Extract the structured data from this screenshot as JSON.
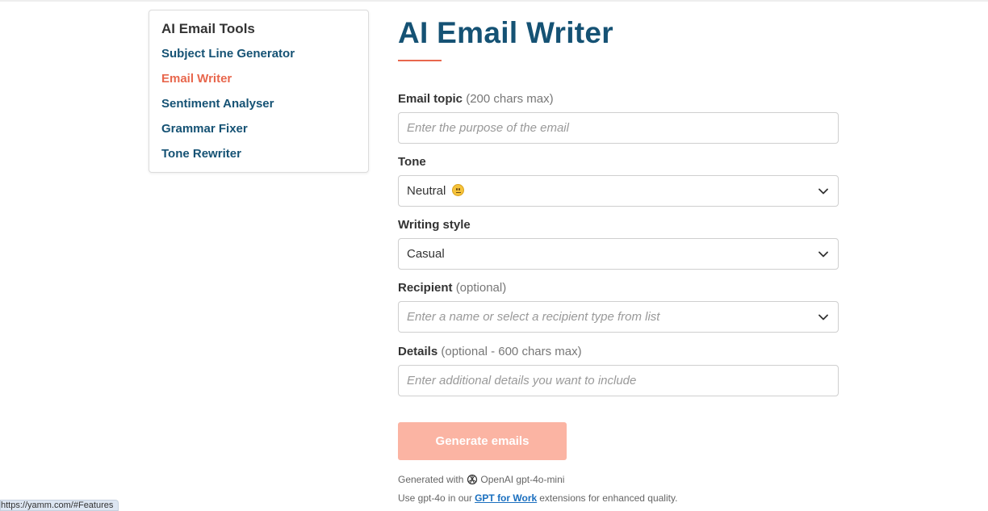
{
  "sidebar": {
    "title": "AI Email Tools",
    "items": [
      {
        "label": "Subject Line Generator",
        "active": false
      },
      {
        "label": "Email Writer",
        "active": true
      },
      {
        "label": "Sentiment Analyser",
        "active": false
      },
      {
        "label": "Grammar Fixer",
        "active": false
      },
      {
        "label": "Tone Rewriter",
        "active": false
      }
    ]
  },
  "main": {
    "title": "AI Email Writer",
    "topic": {
      "label": "Email topic",
      "hint": "(200 chars max)",
      "placeholder": "Enter the purpose of the email"
    },
    "tone": {
      "label": "Tone",
      "value": "Neutral"
    },
    "style": {
      "label": "Writing style",
      "value": "Casual"
    },
    "recipient": {
      "label": "Recipient",
      "hint": "(optional)",
      "placeholder": "Enter a name or select a recipient type from list"
    },
    "details": {
      "label": "Details",
      "hint": "(optional - 600 chars max)",
      "placeholder": "Enter additional details you want to include"
    },
    "generate_label": "Generate emails",
    "footnote1": {
      "prefix": "Generated with",
      "model": "OpenAI gpt-4o-mini"
    },
    "footnote2": {
      "prefix": "Use gpt-4o in our",
      "link": "GPT for Work",
      "suffix": "extensions for enhanced quality."
    }
  },
  "status_bar": {
    "url": "https://yamm.com/#Features"
  },
  "colors": {
    "brand": "#155274",
    "accent": "#e8674d",
    "button_disabled": "#fbb4a3",
    "link": "#1a6fbf"
  }
}
